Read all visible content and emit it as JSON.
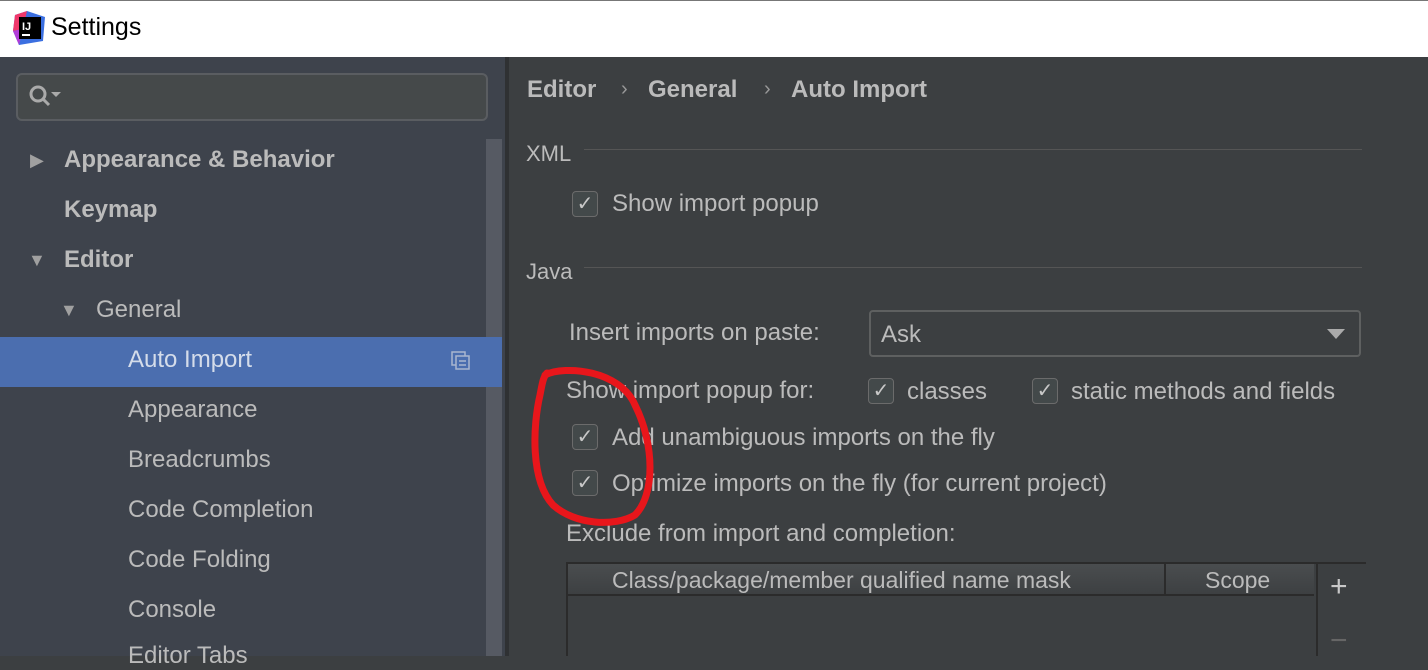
{
  "window": {
    "title": "Settings"
  },
  "search": {
    "placeholder": ""
  },
  "sidebar": {
    "items": [
      {
        "label": "Appearance & Behavior",
        "expanded": false
      },
      {
        "label": "Keymap"
      },
      {
        "label": "Editor",
        "expanded": true
      },
      {
        "label": "General",
        "expanded": true
      },
      {
        "label": "Auto Import",
        "selected": true
      },
      {
        "label": "Appearance"
      },
      {
        "label": "Breadcrumbs"
      },
      {
        "label": "Code Completion"
      },
      {
        "label": "Code Folding"
      },
      {
        "label": "Console"
      },
      {
        "label": "Editor Tabs"
      }
    ]
  },
  "breadcrumb": [
    "Editor",
    "General",
    "Auto Import"
  ],
  "xml": {
    "group": "XML",
    "show_import_popup": {
      "label": "Show import popup",
      "checked": true
    }
  },
  "java": {
    "group": "Java",
    "insert_label": "Insert imports on paste:",
    "insert_value": "Ask",
    "popup_label": "Show import popup for:",
    "classes": {
      "label": "classes",
      "checked": true
    },
    "static": {
      "label": "static methods and fields",
      "checked": true
    },
    "add_unambiguous": {
      "label": "Add unambiguous imports on the fly",
      "checked": true
    },
    "optimize": {
      "label": "Optimize imports on the fly (for current project)",
      "checked": true
    },
    "exclude_label": "Exclude from import and completion:",
    "table_headers": [
      "Class/package/member qualified name mask",
      "Scope"
    ],
    "add": "+",
    "remove": "−"
  },
  "colors": {
    "selection": "#4b6eaf",
    "annotation": "#e8161b"
  }
}
